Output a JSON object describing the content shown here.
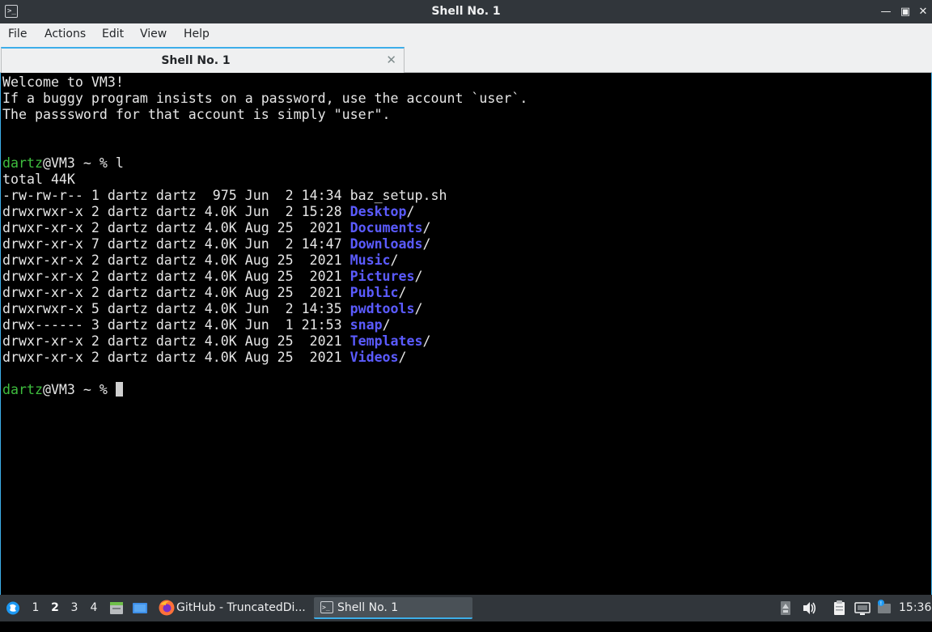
{
  "window": {
    "title": "Shell No. 1",
    "icon": "terminal-icon",
    "controls": [
      "minimize-icon",
      "maximize-icon",
      "close-icon"
    ]
  },
  "menubar": {
    "items": [
      "File",
      "Actions",
      "Edit",
      "View",
      "Help"
    ]
  },
  "tabs": [
    {
      "label": "Shell No. 1",
      "close_icon": "close-icon"
    }
  ],
  "terminal": {
    "welcome": [
      "Welcome to VM3!",
      "If a buggy program insists on a password, use the account `user`.",
      "The passsword for that account is simply \"user\"."
    ],
    "prompt": {
      "user": "dartz",
      "host_rest": "@VM3 ~ % "
    },
    "command": "l",
    "total": "total 44K",
    "listing": [
      {
        "meta": "-rw-rw-r-- 1 dartz dartz  975 Jun  2 14:34 ",
        "name": "baz_setup.sh",
        "is_dir": false,
        "suffix": ""
      },
      {
        "meta": "drwxrwxr-x 2 dartz dartz 4.0K Jun  2 15:28 ",
        "name": "Desktop",
        "is_dir": true,
        "suffix": "/"
      },
      {
        "meta": "drwxr-xr-x 2 dartz dartz 4.0K Aug 25  2021 ",
        "name": "Documents",
        "is_dir": true,
        "suffix": "/"
      },
      {
        "meta": "drwxr-xr-x 7 dartz dartz 4.0K Jun  2 14:47 ",
        "name": "Downloads",
        "is_dir": true,
        "suffix": "/"
      },
      {
        "meta": "drwxr-xr-x 2 dartz dartz 4.0K Aug 25  2021 ",
        "name": "Music",
        "is_dir": true,
        "suffix": "/"
      },
      {
        "meta": "drwxr-xr-x 2 dartz dartz 4.0K Aug 25  2021 ",
        "name": "Pictures",
        "is_dir": true,
        "suffix": "/"
      },
      {
        "meta": "drwxr-xr-x 2 dartz dartz 4.0K Aug 25  2021 ",
        "name": "Public",
        "is_dir": true,
        "suffix": "/"
      },
      {
        "meta": "drwxrwxr-x 5 dartz dartz 4.0K Jun  2 14:35 ",
        "name": "pwdtools",
        "is_dir": true,
        "suffix": "/"
      },
      {
        "meta": "drwx------ 3 dartz dartz 4.0K Jun  1 21:53 ",
        "name": "snap",
        "is_dir": true,
        "suffix": "/"
      },
      {
        "meta": "drwxr-xr-x 2 dartz dartz 4.0K Aug 25  2021 ",
        "name": "Templates",
        "is_dir": true,
        "suffix": "/"
      },
      {
        "meta": "drwxr-xr-x 2 dartz dartz 4.0K Aug 25  2021 ",
        "name": "Videos",
        "is_dir": true,
        "suffix": "/"
      }
    ]
  },
  "taskbar": {
    "workspaces": [
      "1",
      "2",
      "3",
      "4"
    ],
    "active_workspace": "2",
    "tasks": [
      {
        "label": "GitHub - TruncatedDi...",
        "icon": "firefox-icon"
      },
      {
        "label": "Shell No. 1",
        "icon": "terminal-icon"
      }
    ],
    "clock": "15:36"
  },
  "colors": {
    "accent": "#3daee9",
    "prompt_user": "#3ebd3e",
    "directory": "#5b5bff",
    "panel": "#31363b"
  }
}
